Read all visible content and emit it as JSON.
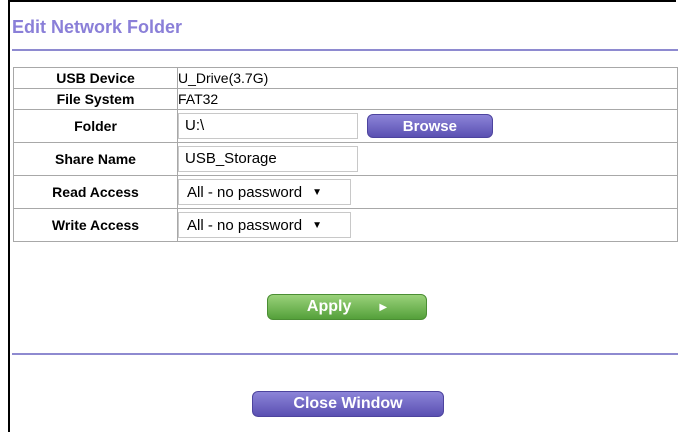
{
  "page": {
    "title": "Edit Network Folder"
  },
  "fields": {
    "usb_device": {
      "label": "USB Device",
      "value": "U_Drive(3.7G)"
    },
    "file_system": {
      "label": "File System",
      "value": "FAT32"
    },
    "folder": {
      "label": "Folder",
      "value": "U:\\",
      "browse_label": "Browse"
    },
    "share_name": {
      "label": "Share Name",
      "value": "USB_Storage"
    },
    "read_access": {
      "label": "Read Access",
      "selected": "All - no password"
    },
    "write_access": {
      "label": "Write Access",
      "selected": "All - no password"
    }
  },
  "actions": {
    "apply_label": "Apply",
    "close_label": "Close Window"
  },
  "icons": {
    "dropdown": "chevron-down-icon",
    "apply_arrow": "play-arrow-icon"
  },
  "colors": {
    "title": "#8a7fd8",
    "rule": "#8e8ad0",
    "primary_button": "#6a60c4",
    "apply_button": "#6fb24e"
  }
}
